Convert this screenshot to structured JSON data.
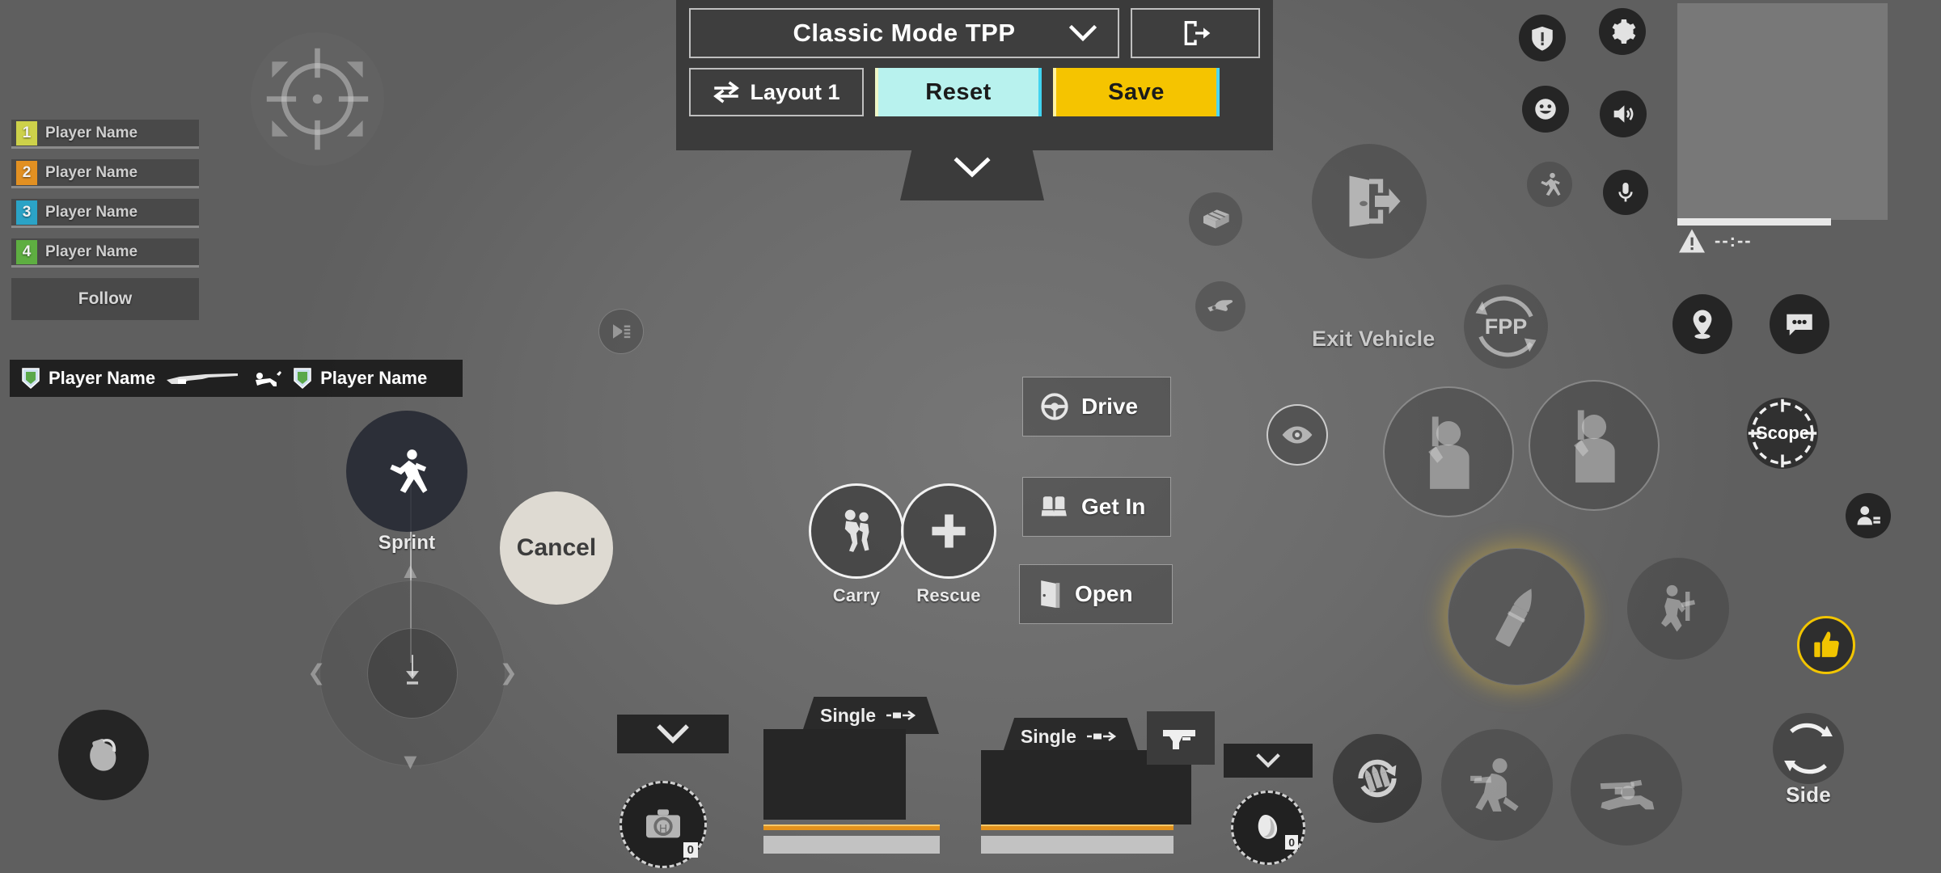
{
  "toolbar": {
    "mode_label": "Classic Mode TPP",
    "mode_chevron_icon": "chevron-down-icon",
    "exit_icon": "exit-door-icon",
    "layout_label": "Layout 1",
    "layout_swap_icon": "swap-arrows-icon",
    "reset_label": "Reset",
    "save_label": "Save",
    "collapse_icon": "chevron-down-icon"
  },
  "team_panel": {
    "members": [
      {
        "num": "1",
        "name": "Player Name",
        "color": "#cdd14a"
      },
      {
        "num": "2",
        "name": "Player Name",
        "color": "#e29022"
      },
      {
        "num": "3",
        "name": "Player Name",
        "color": "#2ba3c6"
      },
      {
        "num": "4",
        "name": "Player Name",
        "color": "#5eae41"
      }
    ],
    "follow_label": "Follow"
  },
  "kill_feed": {
    "killer": "Player Name",
    "victim": "Player Name",
    "weapon_icon": "rifle-icon",
    "state_icon": "knocked-down-icon",
    "badge_icon": "clan-shield-icon"
  },
  "aim": {
    "crosshair_icon": "crosshair-icon",
    "quickchat_icon": "megaphone-icon"
  },
  "left_controls": {
    "sprint_label": "Sprint",
    "sprint_icon": "running-man-icon",
    "cancel_label": "Cancel",
    "grenade_icon": "grenade-icon",
    "joystick_icon": "movement-joystick"
  },
  "center_controls": {
    "carry_label": "Carry",
    "carry_icon": "carry-player-icon",
    "rescue_label": "Rescue",
    "rescue_icon": "plus-icon",
    "drive_label": "Drive",
    "drive_icon": "steering-wheel-icon",
    "getin_label": "Get In",
    "getin_icon": "car-seat-icon",
    "open_label": "Open",
    "open_icon": "door-icon"
  },
  "vehicle_controls": {
    "exit_label": "Exit Vehicle",
    "exit_icon": "exit-vehicle-icon",
    "fpp_label": "FPP",
    "fpp_icon": "camera-toggle-icon",
    "crate_icon": "vehicle-crate-icon",
    "hand_icon": "pointing-hand-icon",
    "peek_icon": "eye-icon"
  },
  "right_controls": {
    "marker_icon": "map-marker-icon",
    "chat_icon": "chat-bubble-icon",
    "scope_label": "Scope",
    "scope_icon": "scope-reticle-icon",
    "players_icon": "player-list-icon",
    "thumbs_up_icon": "thumbs-up-icon",
    "side_label": "Side",
    "side_icon": "peek-rotate-icon",
    "fire_left_icon": "fire-soldier-icon",
    "fire_right_icon": "fire-soldier-icon",
    "ammo_icon": "bullet-icon",
    "jump_icon": "vault-jump-icon",
    "reload_icon": "reload-icon",
    "crouch_icon": "crouch-icon",
    "prone_icon": "prone-icon"
  },
  "top_right_icons": [
    {
      "name": "report-shield-icon"
    },
    {
      "name": "gear-icon"
    },
    {
      "name": "emote-icon"
    },
    {
      "name": "speaker-icon"
    },
    {
      "name": "sprint-toggle-icon"
    },
    {
      "name": "microphone-icon"
    }
  ],
  "minimap": {
    "warning_icon": "warning-triangle-icon",
    "timer_text": "--:--"
  },
  "items": {
    "medkit_icon": "medkit-icon",
    "medkit_count": "0",
    "medkit_chevron_icon": "chevron-down-icon",
    "boost_icon": "energy-drink-icon",
    "boost_count": "0",
    "boost_chevron_icon": "chevron-down-icon"
  },
  "weapons": [
    {
      "fire_mode": "Single",
      "mode_icon": "bullet-travel-icon"
    },
    {
      "fire_mode": "Single",
      "mode_icon": "bullet-travel-icon"
    }
  ],
  "pistol_slot": {
    "icon": "pistol-icon"
  },
  "colors": {
    "save_yellow": "#f5c400",
    "reset_cyan": "#b8f2ee",
    "ammo_orange": "#e3921c",
    "accent_yellow": "#f2c500"
  }
}
